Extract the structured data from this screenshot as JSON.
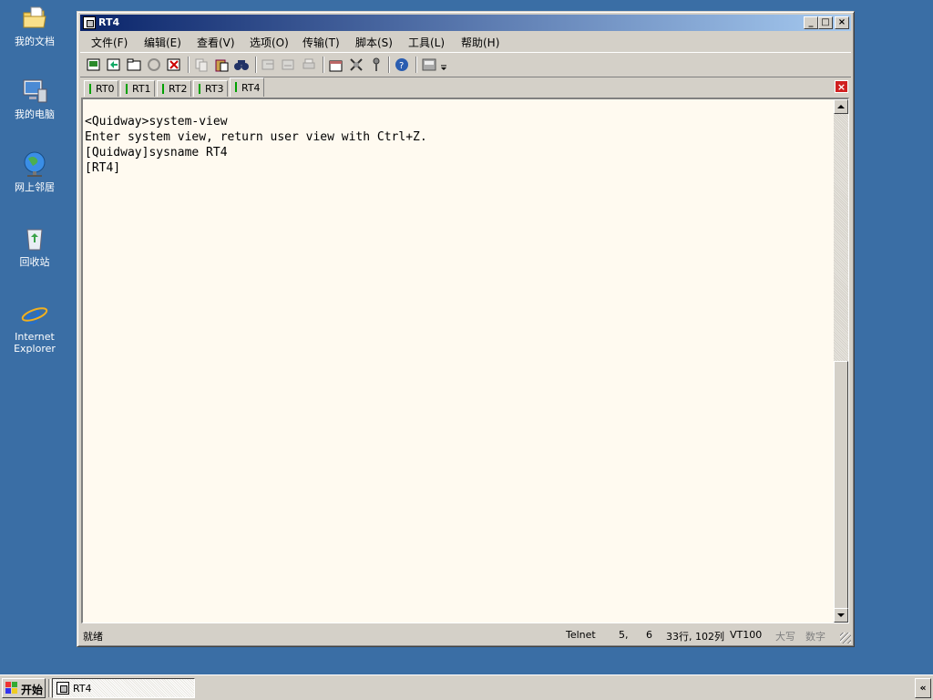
{
  "desktop": {
    "icons": [
      {
        "label": "我的文档",
        "icon": "folder-documents-icon"
      },
      {
        "label": "我的电脑",
        "icon": "computer-icon"
      },
      {
        "label": "网上邻居",
        "icon": "network-icon"
      },
      {
        "label": "回收站",
        "icon": "recycle-bin-icon"
      },
      {
        "label": "Internet\nExplorer",
        "icon": "ie-icon"
      }
    ]
  },
  "window": {
    "title": "RT4",
    "buttons": {
      "minimize": "_",
      "maximize": "□",
      "close": "×"
    }
  },
  "menu": {
    "items": [
      "文件(F)",
      "编辑(E)",
      "查看(V)",
      "选项(O)",
      "传输(T)",
      "脚本(S)",
      "工具(L)",
      "帮助(H)"
    ]
  },
  "tabs": {
    "items": [
      "RT0",
      "RT1",
      "RT2",
      "RT3",
      "RT4"
    ],
    "active": "RT4",
    "close_label": "×"
  },
  "terminal": {
    "lines": [
      "<Quidway>system-view",
      "Enter system view, return user view with Ctrl+Z.",
      "[Quidway]sysname RT4",
      "[RT4]"
    ]
  },
  "statusbar": {
    "ready": "就绪",
    "protocol": "Telnet",
    "row": "5,",
    "col": "6",
    "size": "33行, 102列",
    "terminal_type": "VT100",
    "caps": "大写",
    "num": "数字"
  },
  "taskbar": {
    "start_label": "开始",
    "task_label": "RT4",
    "tray_label": "«"
  },
  "colors": {
    "desktop": "#3a6ea5",
    "titlebar_start": "#0a246a",
    "titlebar_end": "#a6caf0",
    "terminal_bg": "#fffaf0",
    "tab_indicator": "#00a000"
  }
}
